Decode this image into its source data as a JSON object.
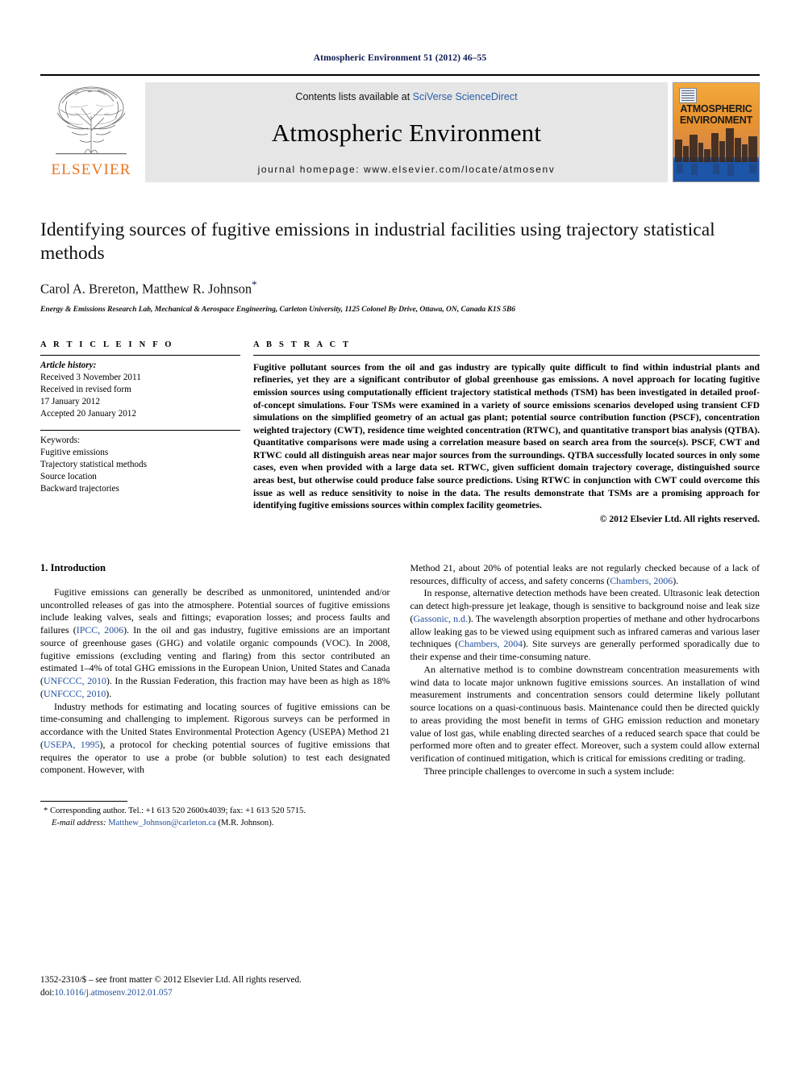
{
  "running_head": "Atmospheric Environment 51 (2012) 46–55",
  "masthead": {
    "publisher_name": "ELSEVIER",
    "contents_prefix": "Contents lists available at ",
    "contents_link": "SciVerse ScienceDirect",
    "journal_title": "Atmospheric Environment",
    "homepage": "journal homepage: www.elsevier.com/locate/atmosenv",
    "cover_title_line1": "ATMOSPHERIC",
    "cover_title_line2": "ENVIRONMENT"
  },
  "article": {
    "title": "Identifying sources of fugitive emissions in industrial facilities using trajectory statistical methods",
    "authors": "Carol A. Brereton, Matthew R. Johnson",
    "corresponding_marker": "*",
    "affiliation": "Energy & Emissions Research Lab, Mechanical & Aerospace Engineering, Carleton University, 1125 Colonel By Drive, Ottawa, ON, Canada K1S 5B6"
  },
  "article_info": {
    "heading": "A R T I C L E   I N F O",
    "history_label": "Article history:",
    "history": [
      "Received 3 November 2011",
      "Received in revised form",
      "17 January 2012",
      "Accepted 20 January 2012"
    ],
    "keywords_label": "Keywords:",
    "keywords": [
      "Fugitive emissions",
      "Trajectory statistical methods",
      "Source location",
      "Backward trajectories"
    ]
  },
  "abstract": {
    "heading": "A B S T R A C T",
    "text": "Fugitive pollutant sources from the oil and gas industry are typically quite difficult to find within industrial plants and refineries, yet they are a significant contributor of global greenhouse gas emissions. A novel approach for locating fugitive emission sources using computationally efficient trajectory statistical methods (TSM) has been investigated in detailed proof-of-concept simulations. Four TSMs were examined in a variety of source emissions scenarios developed using transient CFD simulations on the simplified geometry of an actual gas plant; potential source contribution function (PSCF), concentration weighted trajectory (CWT), residence time weighted concentration (RTWC), and quantitative transport bias analysis (QTBA). Quantitative comparisons were made using a correlation measure based on search area from the source(s). PSCF, CWT and RTWC could all distinguish areas near major sources from the surroundings. QTBA successfully located sources in only some cases, even when provided with a large data set. RTWC, given sufficient domain trajectory coverage, distinguished source areas best, but otherwise could produce false source predictions. Using RTWC in conjunction with CWT could overcome this issue as well as reduce sensitivity to noise in the data. The results demonstrate that TSMs are a promising approach for identifying fugitive emissions sources within complex facility geometries.",
    "copyright": "© 2012 Elsevier Ltd. All rights reserved."
  },
  "body": {
    "section_number_title": "1. Introduction",
    "left_col": {
      "p1_a": "Fugitive emissions can generally be described as unmonitored, unintended and/or uncontrolled releases of gas into the atmosphere. Potential sources of fugitive emissions include leaking valves, seals and fittings; evaporation losses; and process faults and failures (",
      "p1_cite1": "IPCC, 2006",
      "p1_b": "). In the oil and gas industry, fugitive emissions are an important source of greenhouse gases (GHG) and volatile organic compounds (VOC). In 2008, fugitive emissions (excluding venting and flaring) from this sector contributed an estimated 1–4% of total GHG emissions in the European Union, United States and Canada (",
      "p1_cite2": "UNFCCC, 2010",
      "p1_c": "). In the Russian Federation, this fraction may have been as high as 18% (",
      "p1_cite3": "UNFCCC, 2010",
      "p1_d": ").",
      "p2_a": "Industry methods for estimating and locating sources of fugitive emissions can be time-consuming and challenging to implement. Rigorous surveys can be performed in accordance with the United States Environmental Protection Agency (USEPA) Method 21 (",
      "p2_cite1": "USEPA, 1995",
      "p2_b": "), a protocol for checking potential sources of fugitive emissions that requires the operator to use a probe (or bubble solution) to test each designated component. However, with"
    },
    "right_col": {
      "p3_a": "Method 21, about 20% of potential leaks are not regularly checked because of a lack of resources, difficulty of access, and safety concerns (",
      "p3_cite1": "Chambers, 2006",
      "p3_b": ").",
      "p4_a": "In response, alternative detection methods have been created. Ultrasonic leak detection can detect high-pressure jet leakage, though is sensitive to background noise and leak size (",
      "p4_cite1": "Gassonic, n.d.",
      "p4_b": "). The wavelength absorption properties of methane and other hydrocarbons allow leaking gas to be viewed using equipment such as infrared cameras and various laser techniques (",
      "p4_cite2": "Chambers, 2004",
      "p4_c": "). Site surveys are generally performed sporadically due to their expense and their time-consuming nature.",
      "p5": "An alternative method is to combine downstream concentration measurements with wind data to locate major unknown fugitive emissions sources. An installation of wind measurement instruments and concentration sensors could determine likely pollutant source locations on a quasi-continuous basis. Maintenance could then be directed quickly to areas providing the most benefit in terms of GHG emission reduction and monetary value of lost gas, while enabling directed searches of a reduced search space that could be performed more often and to greater effect. Moreover, such a system could allow external verification of continued mitigation, which is critical for emissions crediting or trading.",
      "p6": "Three principle challenges to overcome in such a system include:"
    }
  },
  "footnote": {
    "marker": "*",
    "line1": "Corresponding author. Tel.: +1 613 520 2600x4039; fax: +1 613 520 5715.",
    "email_label": "E-mail address:",
    "email": "Matthew_Johnson@carleton.ca",
    "email_suffix": "(M.R. Johnson)."
  },
  "footer": {
    "issn_line": "1352-2310/$ – see front matter © 2012 Elsevier Ltd. All rights reserved.",
    "doi_label": "doi:",
    "doi": "10.1016/j.atmosenv.2012.01.057"
  },
  "colors": {
    "elsevier_orange": "#E87722",
    "link_blue": "#1f4e9c",
    "running_head_navy": "#0d1a52",
    "masthead_grey": "#e6e6e6"
  }
}
